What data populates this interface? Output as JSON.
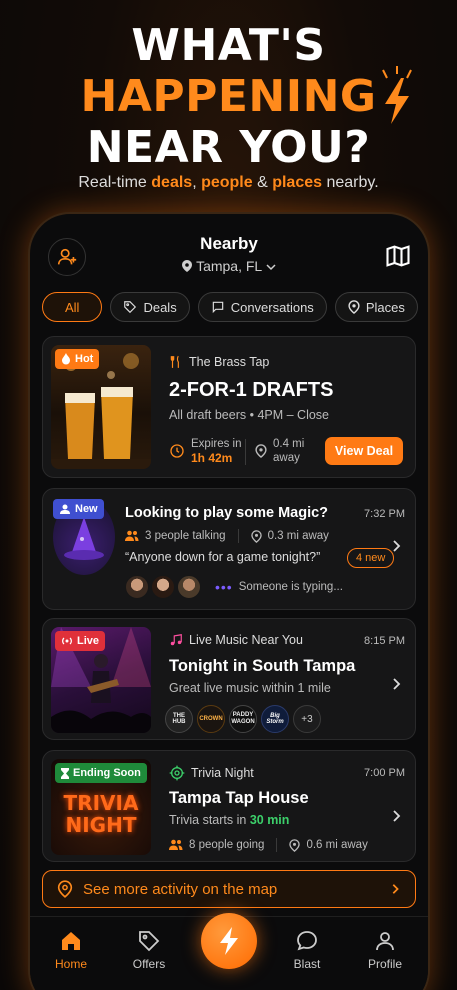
{
  "hero": {
    "line1": "WHAT'S",
    "line2": "HAPPENING",
    "line3": "NEAR YOU?",
    "tag_pre": "Real-time ",
    "tag_deals": "deals",
    "tag_comma": ", ",
    "tag_people": "people",
    "tag_amp": " & ",
    "tag_places": "places",
    "tag_post": " nearby."
  },
  "header": {
    "title": "Nearby",
    "location": "Tampa, FL"
  },
  "filters": [
    {
      "label": "All"
    },
    {
      "label": "Deals"
    },
    {
      "label": "Conversations"
    },
    {
      "label": "Places"
    }
  ],
  "deal_card": {
    "badge": "Hot",
    "venue": "The Brass Tap",
    "title": "2-FOR-1 DRAFTS",
    "subtitle": "All draft beers • 4PM – Close",
    "expires_label": "Expires in",
    "expires_value": "1h 42m",
    "distance_line1": "0.4 mi",
    "distance_line2": "away",
    "cta": "View Deal"
  },
  "convo_card": {
    "badge": "New",
    "title": "Looking to play some Magic?",
    "time": "7:32 PM",
    "people": "3 people talking",
    "distance": "0.3 mi away",
    "quote": "“Anyone down for a game tonight?”",
    "new_count": "4 new",
    "typing": "Someone is typing..."
  },
  "music_card": {
    "badge": "Live",
    "category": "Live Music Near You",
    "time": "8:15 PM",
    "title": "Tonight in South Tampa",
    "subtitle": "Great live music within 1 mile",
    "venues": [
      "THE HUB",
      "CROWN",
      "PADDY WAGON",
      "Big Storm"
    ],
    "more": "+3"
  },
  "trivia_card": {
    "badge": "Ending Soon",
    "sign_line1": "TRIVIA",
    "sign_line2": "NIGHT",
    "category": "Trivia Night",
    "time": "7:00 PM",
    "title": "Tampa Tap House",
    "sub_pre": "Trivia starts in ",
    "sub_time": "30 min",
    "going": "8 people going",
    "distance": "0.6 mi away"
  },
  "map_link": "See more activity on the map",
  "nav": {
    "home": "Home",
    "offers": "Offers",
    "blast": "Blast",
    "profile": "Profile"
  },
  "colors": {
    "accent": "#ff7a14",
    "green": "#1f8a3a",
    "purple": "#4b3fa8",
    "red": "#e0303a"
  }
}
